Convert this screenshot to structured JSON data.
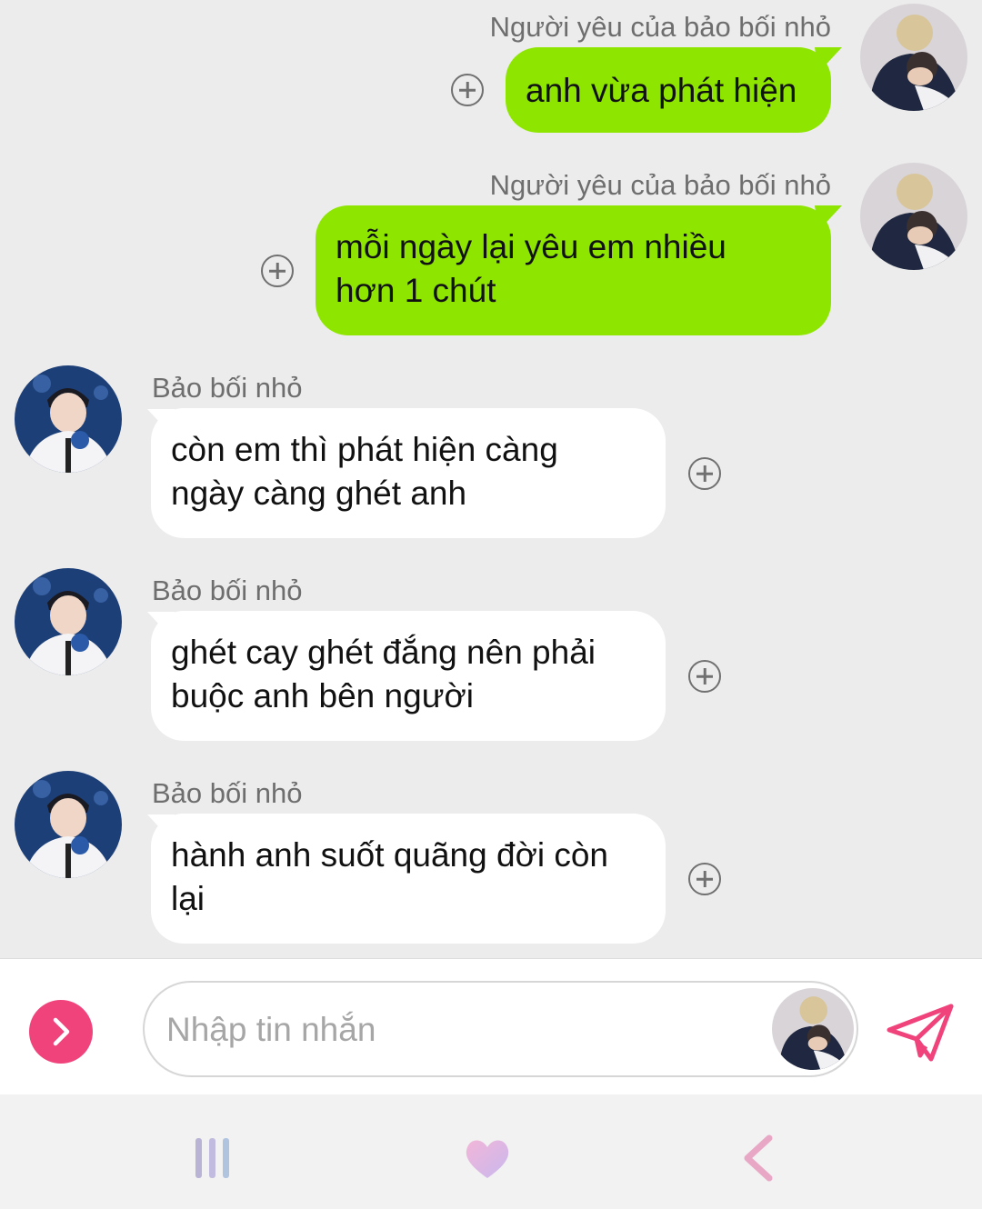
{
  "messages": [
    {
      "side": "right",
      "sender": "Người yêu của bảo bối nhỏ",
      "lines": [
        "anh vừa phát hiện"
      ]
    },
    {
      "side": "right",
      "sender": "Người yêu của bảo bối nhỏ",
      "lines": [
        "mỗi ngày lại yêu em nhiều",
        "hơn 1 chút"
      ]
    },
    {
      "side": "left",
      "sender": "Bảo bối nhỏ",
      "lines": [
        "còn em thì phát hiện càng",
        "ngày càng ghét anh"
      ]
    },
    {
      "side": "left",
      "sender": "Bảo bối nhỏ",
      "lines": [
        "ghét cay ghét đắng nên phải",
        "buộc anh bên người"
      ]
    },
    {
      "side": "left",
      "sender": "Bảo bối nhỏ",
      "lines": [
        "hành anh suốt quãng đời còn",
        "lại"
      ]
    }
  ],
  "composer": {
    "placeholder": "Nhập tin nhắn",
    "value": ""
  },
  "icons": {
    "add_reaction": "plus-circle-icon",
    "expand": "chevron-right-icon",
    "send": "paper-plane-icon",
    "nav_recent": "recent-apps-icon",
    "nav_home": "heart-home-icon",
    "nav_back": "back-chevron-icon"
  },
  "colors": {
    "my_bubble": "#8ee600",
    "their_bubble": "#ffffff",
    "accent": "#f0437c",
    "background": "#ececec"
  }
}
